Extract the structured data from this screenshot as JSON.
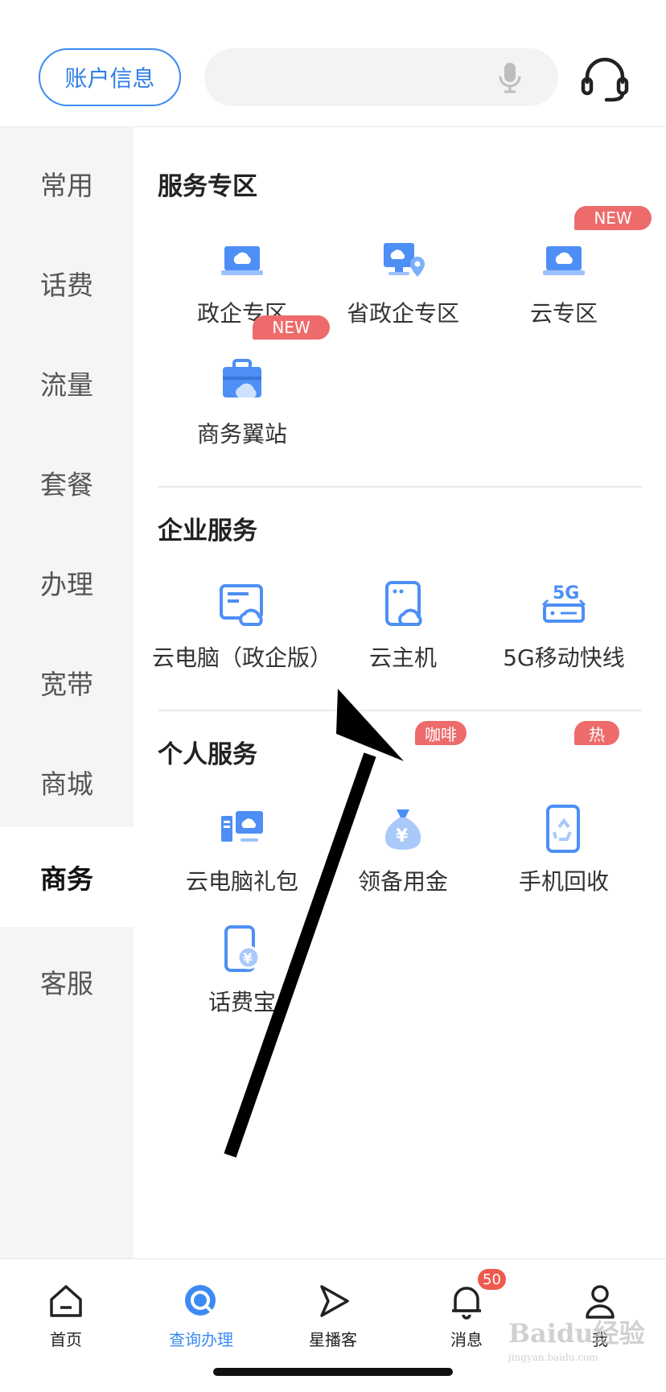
{
  "header": {
    "account_label": "账户信息",
    "search_placeholder": ""
  },
  "sidebar": {
    "items": [
      {
        "label": "常用"
      },
      {
        "label": "话费"
      },
      {
        "label": "流量"
      },
      {
        "label": "套餐"
      },
      {
        "label": "办理"
      },
      {
        "label": "宽带"
      },
      {
        "label": "商城"
      },
      {
        "label": "商务",
        "active": true
      },
      {
        "label": "客服"
      }
    ]
  },
  "main": {
    "sections": [
      {
        "title": "服务专区",
        "items": [
          {
            "label": "政企专区",
            "icon": "laptop-cloud-icon"
          },
          {
            "label": "省政企专区",
            "icon": "monitor-location-icon"
          },
          {
            "label": "云专区",
            "icon": "laptop-cloud-icon",
            "badge": "NEW"
          },
          {
            "label": "商务翼站",
            "icon": "briefcase-cloud-icon",
            "badge": "NEW"
          }
        ]
      },
      {
        "title": "企业服务",
        "items": [
          {
            "label": "云电脑（政企版）",
            "icon": "cloud-pc-icon"
          },
          {
            "label": "云主机",
            "icon": "cloud-host-icon"
          },
          {
            "label": "5G移动快线",
            "icon": "5g-router-icon"
          }
        ]
      },
      {
        "title": "个人服务",
        "items": [
          {
            "label": "云电脑礼包",
            "icon": "pc-cloud-icon"
          },
          {
            "label": "领备用金",
            "icon": "money-bag-icon",
            "badge": "咖啡"
          },
          {
            "label": "手机回收",
            "icon": "phone-recycle-icon",
            "badge": "热"
          },
          {
            "label": "话费宝",
            "icon": "phone-yuan-icon"
          }
        ]
      }
    ]
  },
  "bottom_nav": {
    "items": [
      {
        "label": "首页",
        "icon": "home-icon"
      },
      {
        "label": "查询办理",
        "icon": "search-query-icon",
        "active": true
      },
      {
        "label": "星播客",
        "icon": "play-icon"
      },
      {
        "label": "消息",
        "icon": "bell-icon",
        "badge": "50"
      },
      {
        "label": "我",
        "icon": "user-icon"
      }
    ]
  },
  "watermark": {
    "text": "Baidu经验",
    "sub": "jingyan.baidu.com"
  },
  "colors": {
    "accent": "#3d8bf2",
    "badge": "#ee6b6b",
    "sidebar_bg": "#f5f5f5"
  }
}
